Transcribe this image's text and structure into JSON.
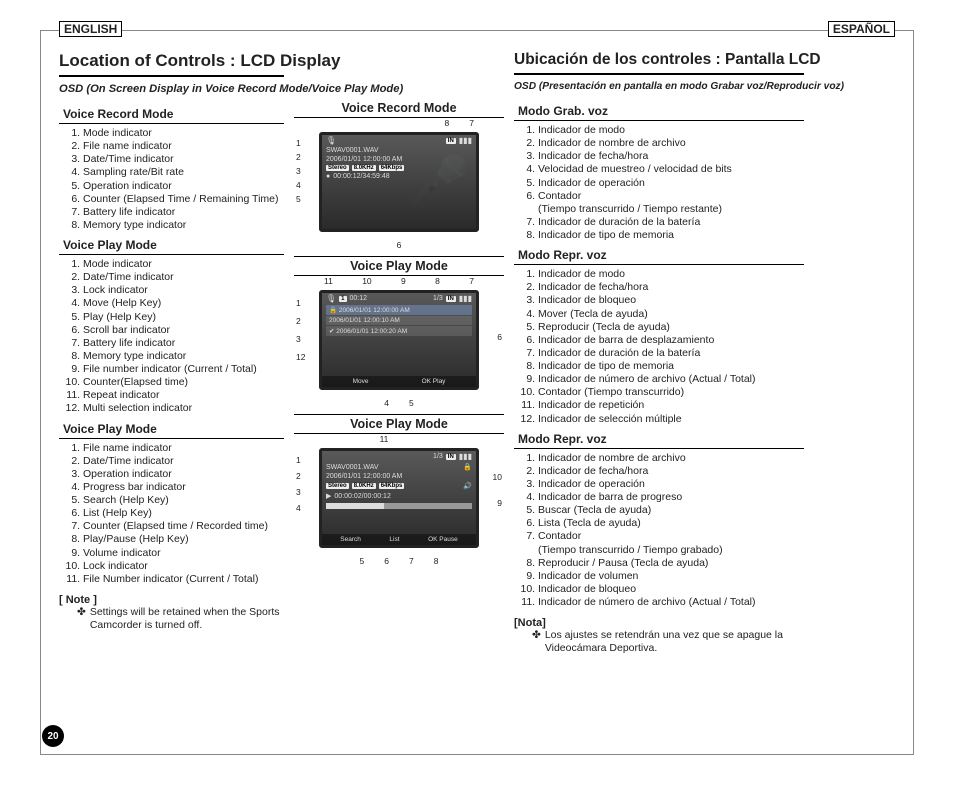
{
  "page_number": "20",
  "lang_badges": {
    "en": "ENGLISH",
    "es": "ESPAÑOL"
  },
  "en": {
    "title": "Location of Controls : LCD Display",
    "subtitle": "OSD (On Screen Display in Voice Record Mode/Voice Play Mode)",
    "sections": [
      {
        "head": "Voice Record Mode",
        "items": [
          "Mode indicator",
          "File name indicator",
          "Date/Time indicator",
          "Sampling rate/Bit rate",
          "Operation indicator",
          "Counter (Elapsed Time / Remaining Time)",
          "Battery life indicator",
          "Memory type indicator"
        ]
      },
      {
        "head": "Voice Play Mode",
        "items": [
          "Mode indicator",
          "Date/Time indicator",
          "Lock indicator",
          "Move (Help Key)",
          "Play (Help Key)",
          "Scroll bar indicator",
          "Battery life indicator",
          "Memory type indicator",
          "File number indicator (Current / Total)",
          "Counter(Elapsed time)",
          "Repeat indicator",
          "Multi selection indicator"
        ]
      },
      {
        "head": "Voice Play Mode",
        "items": [
          "File name indicator",
          "Date/Time indicator",
          "Operation indicator",
          "Progress bar indicator",
          "Search (Help Key)",
          "List (Help Key)",
          "Counter (Elapsed time / Recorded time)",
          "Play/Pause (Help Key)",
          "Volume indicator",
          "Lock indicator",
          "File Number indicator (Current / Total)"
        ]
      }
    ],
    "note_head": "[ Note ]",
    "note_body": "Settings will be retained when the Sports Camcorder is turned off."
  },
  "es": {
    "title": "Ubicación de los controles : Pantalla LCD",
    "subtitle": "OSD (Presentación en pantalla en modo Grabar voz/Reproducir voz)",
    "sections": [
      {
        "head": "Modo Grab. voz",
        "items": [
          "Indicador de modo",
          "Indicador de nombre de archivo",
          "Indicador de fecha/hora",
          "Velocidad de muestreo / velocidad de bits",
          "Indicador de operación",
          "Contador",
          "Indicador de duración de la batería",
          "Indicador de tipo de memoria"
        ],
        "sub_after_6": "(Tiempo transcurrido / Tiempo restante)"
      },
      {
        "head": "Modo Repr. voz",
        "items": [
          "Indicador de modo",
          "Indicador de fecha/hora",
          "Indicador de bloqueo",
          "Mover (Tecla de ayuda)",
          "Reproducir (Tecla de ayuda)",
          "Indicador de barra de desplazamiento",
          "Indicador de duración de la batería",
          "Indicador de tipo de memoria",
          "Indicador de número de archivo (Actual / Total)",
          "Contador (Tiempo transcurrido)",
          "Indicador de repetición",
          "Indicador de selección múltiple"
        ]
      },
      {
        "head": "Modo Repr. voz",
        "items": [
          "Indicador de nombre de archivo",
          "Indicador de fecha/hora",
          "Indicador de operación",
          "Indicador de barra de progreso",
          "Buscar (Tecla de ayuda)",
          "Lista (Tecla de ayuda)",
          "Contador",
          "Reproducir / Pausa (Tecla de ayuda)",
          "Indicador de volumen",
          "Indicador de bloqueo",
          "Indicador de número de archivo (Actual / Total)"
        ],
        "sub_after_7": "(Tiempo transcurrido / Tiempo grabado)"
      }
    ],
    "note_head": "[Nota]",
    "note_body": "Los ajustes se retendrán una vez que se apague la Videocámara Deportiva."
  },
  "figs": {
    "fig1": {
      "title": "Voice Record Mode",
      "callouts_left": [
        "1",
        "2",
        "3",
        "4",
        "5"
      ],
      "callouts_top": [
        "8",
        "7"
      ],
      "callouts_bot": [
        "6"
      ],
      "lcd": {
        "file": "SWAV0001.WAV",
        "datetime": "2006/01/01 12:00:00 AM",
        "stereo": "Stereo",
        "khz": "8.0KHz",
        "kbps": "64Kbps",
        "rec": "●",
        "counter": "00:00:12/34:59:48",
        "in": "IN",
        "batt": "▮▮▮"
      }
    },
    "fig2": {
      "title": "Voice Play Mode",
      "callouts_left": [
        "1",
        "2",
        "3",
        "12"
      ],
      "callouts_top": [
        "11",
        "10",
        "9",
        "8",
        "7"
      ],
      "callouts_right": [
        "6"
      ],
      "callouts_bot": [
        "4",
        "5"
      ],
      "lcd": {
        "repeat": "1",
        "elapsed": "00:12",
        "frac": "1/3",
        "in": "IN",
        "batt": "▮▮▮",
        "rows": [
          {
            "lock": "🔒",
            "dt": "2006/01/01 12:00:00 AM"
          },
          {
            "lock": "",
            "dt": "2006/01/01 12:00:10 AM"
          },
          {
            "lock": "✔",
            "dt": "2006/01/01 12:00:20 AM"
          }
        ],
        "help_move": "Move",
        "help_play": "OK Play"
      }
    },
    "fig3": {
      "title": "Voice Play Mode",
      "callouts_left": [
        "1",
        "2",
        "3",
        "4"
      ],
      "callouts_top": [
        "11"
      ],
      "callouts_right": [
        "10",
        "9"
      ],
      "callouts_bot": [
        "5",
        "6",
        "7",
        "8"
      ],
      "lcd": {
        "file": "SWAV0001.WAV",
        "datetime": "2006/01/01 12:00:00 AM",
        "stereo": "Stereo",
        "khz": "8.0KHz",
        "kbps": "64Kbps",
        "frac": "1/3",
        "in": "IN",
        "batt": "▮▮▮",
        "lock": "🔒",
        "play": "▶",
        "counter": "00:00:02/00:00:12",
        "vol": "🔊",
        "help_search": "Search",
        "help_list": "List",
        "help_pause": "OK Pause"
      }
    }
  }
}
